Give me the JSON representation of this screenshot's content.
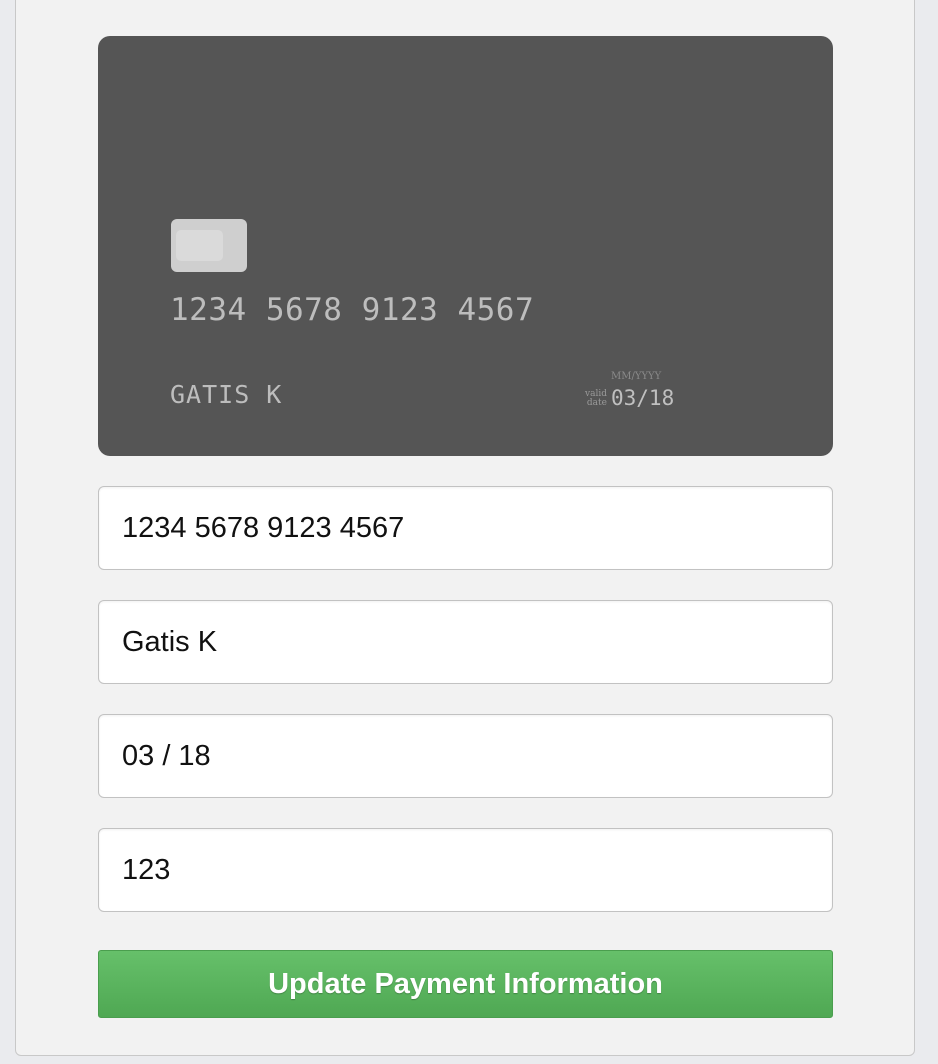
{
  "card_preview": {
    "number": "1234 5678 9123 4567",
    "name": "GATIS K",
    "expiry_format": "MM/YYYY",
    "valid_label": "valid date",
    "expiry": "03/18"
  },
  "form": {
    "card_number_value": "1234 5678 9123 4567",
    "name_value": "Gatis K",
    "expiry_value": "03 / 18",
    "cvc_value": "123",
    "submit_label": "Update Payment Information"
  },
  "colors": {
    "card_background": "#555555",
    "button_green": "#5cb85c",
    "panel_background": "#f2f2f2"
  }
}
